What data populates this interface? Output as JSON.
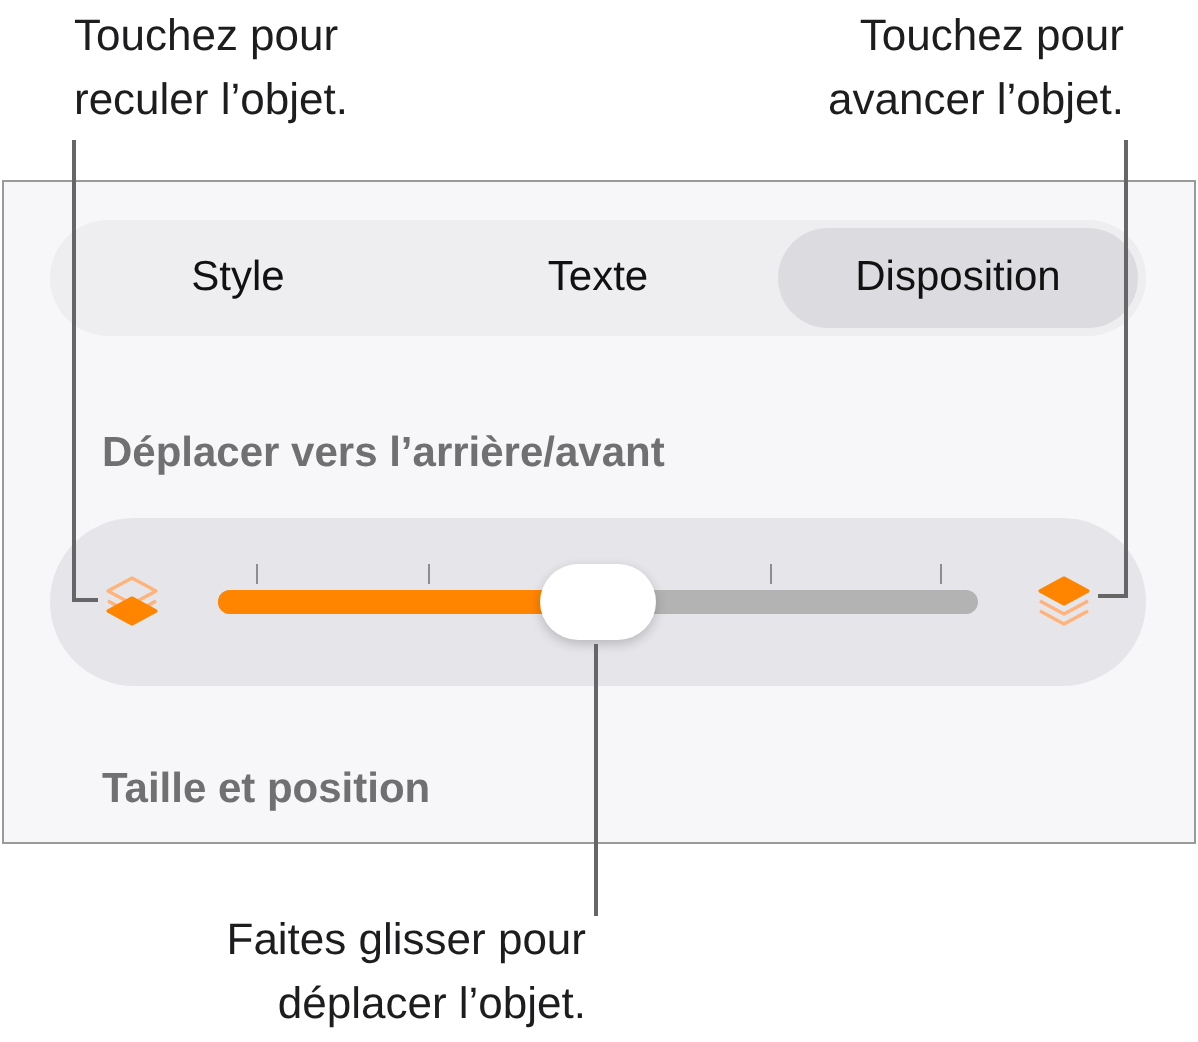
{
  "callouts": [
    {
      "text": "Touchez pour\nreculer l’objet."
    },
    {
      "text": "Touchez pour\navancer l’objet."
    },
    {
      "text": "Faites glisser pour\ndéplacer l’objet."
    }
  ],
  "tabs": [
    {
      "label": "Style",
      "selected": false
    },
    {
      "label": "Texte",
      "selected": false
    },
    {
      "label": "Disposition",
      "selected": true
    }
  ],
  "arrange": {
    "title": "Déplacer vers l’arrière/avant",
    "level": 0.5
  },
  "next_section": {
    "title": "Taille et position"
  }
}
